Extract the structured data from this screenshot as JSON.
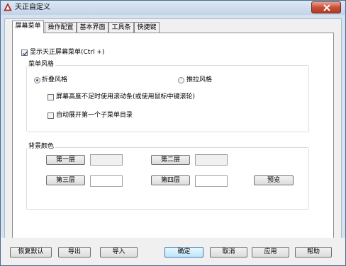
{
  "window": {
    "title": "天正自定义",
    "icon": "app-icon",
    "close_icon": "close-icon"
  },
  "tabs": [
    {
      "label": "屏幕菜单",
      "active": true
    },
    {
      "label": "操作配置",
      "active": false
    },
    {
      "label": "基本界面",
      "active": false
    },
    {
      "label": "工具条",
      "active": false
    },
    {
      "label": "快捷键",
      "active": false
    }
  ],
  "screen_menu": {
    "show_menu": {
      "label": "显示天正屏幕菜单(Ctrl +)",
      "checked": true
    },
    "menu_style": {
      "title": "菜单风格",
      "folding": {
        "label": "折叠风格",
        "selected": true
      },
      "pulling": {
        "label": "推拉风格",
        "selected": false
      },
      "scrollbar": {
        "label": "屏幕高度不足时使用滚动条(或使用鼠标中键滚轮)",
        "checked": false
      },
      "auto_expand": {
        "label": "自动展开第一个子菜单目录",
        "checked": false
      }
    },
    "background": {
      "title": "背景颜色",
      "layer1": {
        "label": "第一层",
        "color": "#f0f0f0"
      },
      "layer2": {
        "label": "第二层",
        "color": "#f0f0f0"
      },
      "layer3": {
        "label": "第三层",
        "color": "#ffffff"
      },
      "layer4": {
        "label": "第四层",
        "color": "#ffffff"
      },
      "preview": "预览"
    }
  },
  "footer": {
    "restore": "恢复默认",
    "export": "导出",
    "import": "导入",
    "ok": "确定",
    "cancel": "取消",
    "apply": "应用",
    "help": "帮助"
  },
  "colors": {
    "accent": "#3c7fb1",
    "close": "#c8503a",
    "title_bar": "#c3d4e8"
  }
}
